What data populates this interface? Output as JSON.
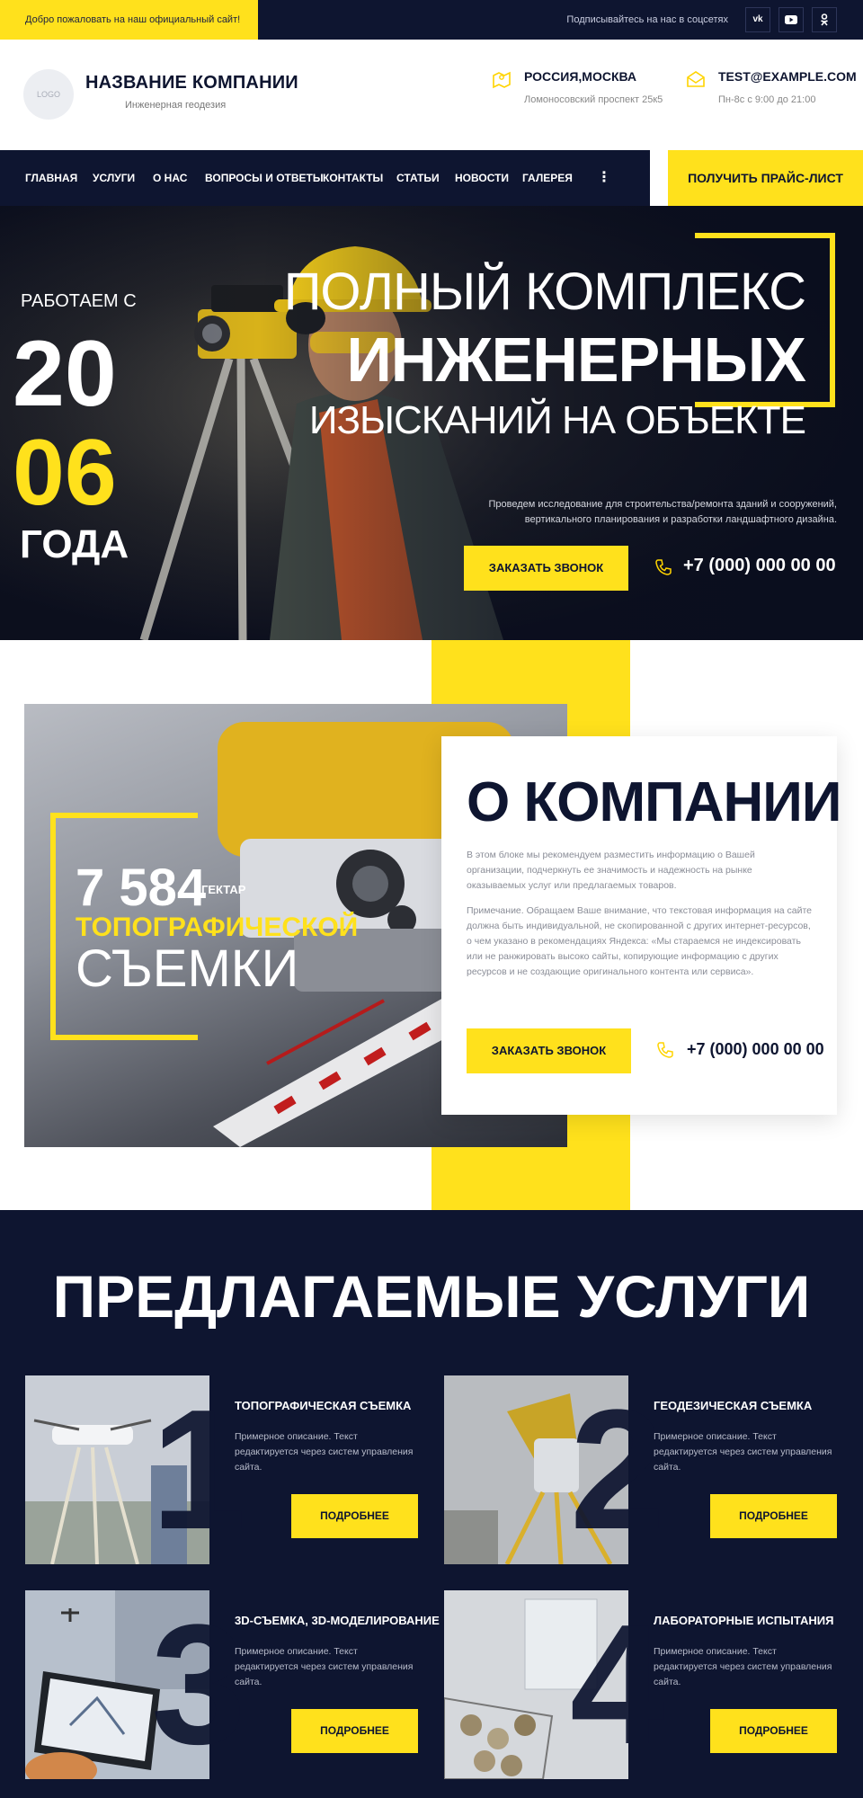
{
  "topbar": {
    "welcome": "Добро пожаловать на наш официальный сайт!",
    "subscribe": "Подписывайтесь на нас в соцсетях",
    "social": [
      "vk",
      "yt",
      "ok"
    ]
  },
  "header": {
    "logo": "LOGO",
    "company_name": "НАЗВАНИЕ КОМПАНИИ",
    "company_desc": "Инженерная геодезия",
    "location_title": "РОССИЯ,МОСКВА",
    "location_sub": "Ломоносовский проспект 25к5",
    "email_title": "TEST@EXAMPLE.COM",
    "email_sub": "Пн-8с с 9:00 до 21:00"
  },
  "nav": {
    "items": [
      "ГЛАВНАЯ",
      "УСЛУГИ",
      "О НАС",
      "ВОПРОСЫ И ОТВЕТЫ",
      "КОНТАКТЫ",
      "СТАТЬИ",
      "НОВОСТИ",
      "ГАЛЕРЕЯ",
      "⋮"
    ],
    "price_button": "ПОЛУЧИТЬ ПРАЙС-ЛИСТ"
  },
  "hero": {
    "since_label": "РАБОТАЕМ С",
    "year_top": "20",
    "year_bottom": "06",
    "year_suffix": "ГОДА",
    "headline_1": "ПОЛНЫЙ КОМПЛЕКС",
    "headline_2": "ИНЖЕНЕРНЫХ",
    "headline_3": "ИЗЫСКАНИЙ НА ОБЪЕКТЕ",
    "description": "Проведем исследование для строительства/ремонта зданий и сооружений, вертикального планирования и разработки ландшафтного дизайна.",
    "call_button": "ЗАКАЗАТЬ ЗВОНОК",
    "phone": "+7 (000) 000 00 00"
  },
  "about": {
    "stat_number": "7 584",
    "stat_unit": "ГЕКТАР",
    "stat_line1": "ТОПОГРАФИЧЕСКОЙ",
    "stat_line2": "СЪЕМКИ",
    "title": "О КОМПАНИИ",
    "paragraph_1": "В этом блоке мы рекомендуем разместить информацию о Вашей организации, подчеркнуть ее значимость и надежность на рынке оказываемых услуг или предлагаемых товаров.",
    "paragraph_2": "Примечание. Обращаем Ваше внимание, что текстовая информация на сайте должна быть индивидуальной, не скопированной с других интернет-ресурсов, о чем указано в рекомендациях Яндекса: «Мы стараемся не индексировать или не ранжировать высоко сайты, копирующие информацию с других ресурсов и не создающие оригинального контента или сервиса».",
    "call_button": "ЗАКАЗАТЬ ЗВОНОК",
    "phone": "+7 (000) 000 00 00"
  },
  "services": {
    "title": "ПРЕДЛАГАЕМЫЕ УСЛУГИ",
    "items": [
      {
        "num": "1",
        "title": "ТОПОГРАФИЧЕСКАЯ СЪЕМКА",
        "text": "Примерное описание. Текст редактируется через систем управления сайта.",
        "button": "ПОДРОБНЕЕ"
      },
      {
        "num": "2",
        "title": "ГЕОДЕЗИЧЕСКАЯ СЪЕМКА",
        "text": "Примерное описание. Текст редактируется через систем управления сайта.",
        "button": "ПОДРОБНЕЕ"
      },
      {
        "num": "3",
        "title": "3D-СЪЕМКА, 3D-МОДЕЛИРОВАНИЕ",
        "text": "Примерное описание. Текст редактируется через систем управления сайта.",
        "button": "ПОДРОБНЕЕ"
      },
      {
        "num": "4",
        "title": "ЛАБОРАТОРНЫЕ ИСПЫТАНИЯ",
        "text": "Примерное описание. Текст редактируется через систем управления сайта.",
        "button": "ПОДРОБНЕЕ"
      }
    ]
  },
  "colors": {
    "navy": "#0e1530",
    "yellow": "#ffe11c"
  }
}
